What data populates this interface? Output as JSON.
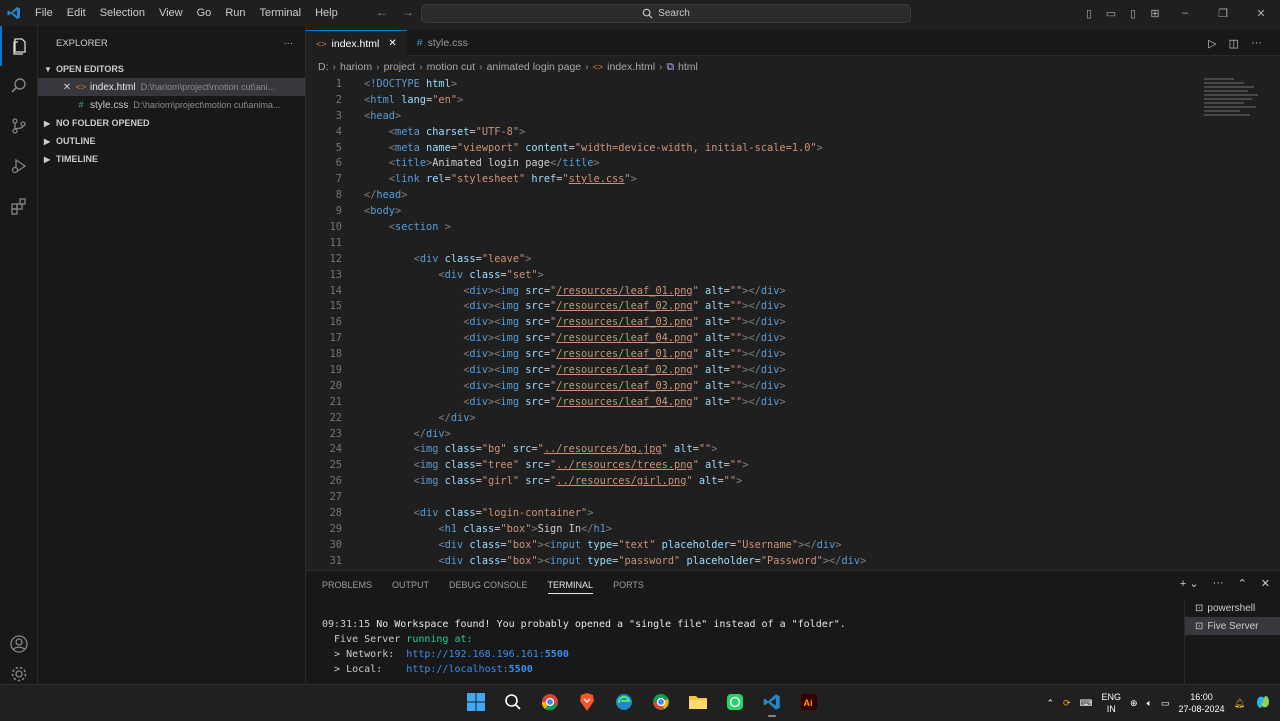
{
  "titlebar": {
    "menu": [
      "File",
      "Edit",
      "Selection",
      "View",
      "Go",
      "Run",
      "Terminal",
      "Help"
    ],
    "search": "Search"
  },
  "sidebar": {
    "title": "EXPLORER",
    "more": "···",
    "open_editors": "OPEN EDITORS",
    "files": [
      {
        "name": "index.html",
        "path": "D:\\hariom\\project\\motion cut\\ani..."
      },
      {
        "name": "style.css",
        "path": "D:\\hariom\\project\\motion cut\\anima..."
      }
    ],
    "sections": [
      "NO FOLDER OPENED",
      "OUTLINE",
      "TIMELINE"
    ]
  },
  "tabs": [
    {
      "label": "index.html",
      "icon": "<>"
    },
    {
      "label": "style.css",
      "icon": "#"
    }
  ],
  "breadcrumb": [
    "D:",
    "hariom",
    "project",
    "motion cut",
    "animated login page",
    "index.html",
    "html"
  ],
  "code_lines": [
    {
      "n": "1",
      "tokens": [
        [
          "p",
          "<"
        ],
        [
          "t",
          "!DOCTYPE "
        ],
        [
          "a",
          "html"
        ],
        [
          "p",
          ">"
        ]
      ]
    },
    {
      "n": "2",
      "tokens": [
        [
          "p",
          "<"
        ],
        [
          "t",
          "html "
        ],
        [
          "a",
          "lang"
        ],
        [
          "c",
          "="
        ],
        [
          "s",
          "\"en\""
        ],
        [
          "p",
          ">"
        ]
      ]
    },
    {
      "n": "3",
      "tokens": [
        [
          "p",
          "<"
        ],
        [
          "t",
          "head"
        ],
        [
          "p",
          ">"
        ]
      ]
    },
    {
      "n": "4",
      "tokens": [
        [
          "c",
          "    "
        ],
        [
          "p",
          "<"
        ],
        [
          "t",
          "meta "
        ],
        [
          "a",
          "charset"
        ],
        [
          "c",
          "="
        ],
        [
          "s",
          "\"UTF-8\""
        ],
        [
          "p",
          ">"
        ]
      ]
    },
    {
      "n": "5",
      "tokens": [
        [
          "c",
          "    "
        ],
        [
          "p",
          "<"
        ],
        [
          "t",
          "meta "
        ],
        [
          "a",
          "name"
        ],
        [
          "c",
          "="
        ],
        [
          "s",
          "\"viewport\" "
        ],
        [
          "a",
          "content"
        ],
        [
          "c",
          "="
        ],
        [
          "s",
          "\"width=device-width, initial-scale=1.0\""
        ],
        [
          "p",
          ">"
        ]
      ]
    },
    {
      "n": "6",
      "tokens": [
        [
          "c",
          "    "
        ],
        [
          "p",
          "<"
        ],
        [
          "t",
          "title"
        ],
        [
          "p",
          ">"
        ],
        [
          "c",
          "Animated login page"
        ],
        [
          "p",
          "</"
        ],
        [
          "t",
          "title"
        ],
        [
          "p",
          ">"
        ]
      ]
    },
    {
      "n": "7",
      "tokens": [
        [
          "c",
          "    "
        ],
        [
          "p",
          "<"
        ],
        [
          "t",
          "link "
        ],
        [
          "a",
          "rel"
        ],
        [
          "c",
          "="
        ],
        [
          "s",
          "\"stylesheet\" "
        ],
        [
          "a",
          "href"
        ],
        [
          "c",
          "="
        ],
        [
          "s",
          "\""
        ],
        [
          "u",
          "style.css"
        ],
        [
          "s",
          "\""
        ],
        [
          "p",
          ">"
        ]
      ]
    },
    {
      "n": "8",
      "tokens": [
        [
          "p",
          "</"
        ],
        [
          "t",
          "head"
        ],
        [
          "p",
          ">"
        ]
      ]
    },
    {
      "n": "9",
      "tokens": [
        [
          "p",
          "<"
        ],
        [
          "t",
          "body"
        ],
        [
          "p",
          ">"
        ]
      ]
    },
    {
      "n": "10",
      "tokens": [
        [
          "c",
          "    "
        ],
        [
          "p",
          "<"
        ],
        [
          "t",
          "section "
        ],
        [
          "p",
          ">"
        ]
      ]
    },
    {
      "n": "11",
      "tokens": []
    },
    {
      "n": "12",
      "tokens": [
        [
          "c",
          "        "
        ],
        [
          "p",
          "<"
        ],
        [
          "t",
          "div "
        ],
        [
          "a",
          "class"
        ],
        [
          "c",
          "="
        ],
        [
          "s",
          "\"leave\""
        ],
        [
          "p",
          ">"
        ]
      ]
    },
    {
      "n": "13",
      "tokens": [
        [
          "c",
          "            "
        ],
        [
          "p",
          "<"
        ],
        [
          "t",
          "div "
        ],
        [
          "a",
          "class"
        ],
        [
          "c",
          "="
        ],
        [
          "s",
          "\"set\""
        ],
        [
          "p",
          ">"
        ]
      ]
    },
    {
      "n": "14",
      "tokens": [
        [
          "c",
          "                "
        ],
        [
          "p",
          "<"
        ],
        [
          "t",
          "div"
        ],
        [
          "p",
          "><"
        ],
        [
          "t",
          "img "
        ],
        [
          "a",
          "src"
        ],
        [
          "c",
          "="
        ],
        [
          "s",
          "\""
        ],
        [
          "u",
          "/resources/leaf_01.png"
        ],
        [
          "s",
          "\" "
        ],
        [
          "a",
          "alt"
        ],
        [
          "c",
          "="
        ],
        [
          "s",
          "\"\""
        ],
        [
          "p",
          "></"
        ],
        [
          "t",
          "div"
        ],
        [
          "p",
          ">"
        ]
      ]
    },
    {
      "n": "15",
      "tokens": [
        [
          "c",
          "                "
        ],
        [
          "p",
          "<"
        ],
        [
          "t",
          "div"
        ],
        [
          "p",
          "><"
        ],
        [
          "t",
          "img "
        ],
        [
          "a",
          "src"
        ],
        [
          "c",
          "="
        ],
        [
          "s",
          "\""
        ],
        [
          "u",
          "/resources/leaf_02.png"
        ],
        [
          "s",
          "\" "
        ],
        [
          "a",
          "alt"
        ],
        [
          "c",
          "="
        ],
        [
          "s",
          "\"\""
        ],
        [
          "p",
          "></"
        ],
        [
          "t",
          "div"
        ],
        [
          "p",
          ">"
        ]
      ]
    },
    {
      "n": "16",
      "tokens": [
        [
          "c",
          "                "
        ],
        [
          "p",
          "<"
        ],
        [
          "t",
          "div"
        ],
        [
          "p",
          "><"
        ],
        [
          "t",
          "img "
        ],
        [
          "a",
          "src"
        ],
        [
          "c",
          "="
        ],
        [
          "s",
          "\""
        ],
        [
          "u",
          "/resources/leaf_03.png"
        ],
        [
          "s",
          "\" "
        ],
        [
          "a",
          "alt"
        ],
        [
          "c",
          "="
        ],
        [
          "s",
          "\"\""
        ],
        [
          "p",
          "></"
        ],
        [
          "t",
          "div"
        ],
        [
          "p",
          ">"
        ]
      ]
    },
    {
      "n": "17",
      "tokens": [
        [
          "c",
          "                "
        ],
        [
          "p",
          "<"
        ],
        [
          "t",
          "div"
        ],
        [
          "p",
          "><"
        ],
        [
          "t",
          "img "
        ],
        [
          "a",
          "src"
        ],
        [
          "c",
          "="
        ],
        [
          "s",
          "\""
        ],
        [
          "u",
          "/resources/leaf_04.png"
        ],
        [
          "s",
          "\" "
        ],
        [
          "a",
          "alt"
        ],
        [
          "c",
          "="
        ],
        [
          "s",
          "\"\""
        ],
        [
          "p",
          "></"
        ],
        [
          "t",
          "div"
        ],
        [
          "p",
          ">"
        ]
      ]
    },
    {
      "n": "18",
      "tokens": [
        [
          "c",
          "                "
        ],
        [
          "p",
          "<"
        ],
        [
          "t",
          "div"
        ],
        [
          "p",
          "><"
        ],
        [
          "t",
          "img "
        ],
        [
          "a",
          "src"
        ],
        [
          "c",
          "="
        ],
        [
          "s",
          "\""
        ],
        [
          "u",
          "/resources/leaf_01.png"
        ],
        [
          "s",
          "\" "
        ],
        [
          "a",
          "alt"
        ],
        [
          "c",
          "="
        ],
        [
          "s",
          "\"\""
        ],
        [
          "p",
          "></"
        ],
        [
          "t",
          "div"
        ],
        [
          "p",
          ">"
        ]
      ]
    },
    {
      "n": "19",
      "tokens": [
        [
          "c",
          "                "
        ],
        [
          "p",
          "<"
        ],
        [
          "t",
          "div"
        ],
        [
          "p",
          "><"
        ],
        [
          "t",
          "img "
        ],
        [
          "a",
          "src"
        ],
        [
          "c",
          "="
        ],
        [
          "s",
          "\""
        ],
        [
          "u",
          "/resources/leaf_02.png"
        ],
        [
          "s",
          "\" "
        ],
        [
          "a",
          "alt"
        ],
        [
          "c",
          "="
        ],
        [
          "s",
          "\"\""
        ],
        [
          "p",
          "></"
        ],
        [
          "t",
          "div"
        ],
        [
          "p",
          ">"
        ]
      ]
    },
    {
      "n": "20",
      "tokens": [
        [
          "c",
          "                "
        ],
        [
          "p",
          "<"
        ],
        [
          "t",
          "div"
        ],
        [
          "p",
          "><"
        ],
        [
          "t",
          "img "
        ],
        [
          "a",
          "src"
        ],
        [
          "c",
          "="
        ],
        [
          "s",
          "\""
        ],
        [
          "u",
          "/resources/leaf_03.png"
        ],
        [
          "s",
          "\" "
        ],
        [
          "a",
          "alt"
        ],
        [
          "c",
          "="
        ],
        [
          "s",
          "\"\""
        ],
        [
          "p",
          "></"
        ],
        [
          "t",
          "div"
        ],
        [
          "p",
          ">"
        ]
      ]
    },
    {
      "n": "21",
      "tokens": [
        [
          "c",
          "                "
        ],
        [
          "p",
          "<"
        ],
        [
          "t",
          "div"
        ],
        [
          "p",
          "><"
        ],
        [
          "t",
          "img "
        ],
        [
          "a",
          "src"
        ],
        [
          "c",
          "="
        ],
        [
          "s",
          "\""
        ],
        [
          "u",
          "/resources/leaf_04.png"
        ],
        [
          "s",
          "\" "
        ],
        [
          "a",
          "alt"
        ],
        [
          "c",
          "="
        ],
        [
          "s",
          "\"\""
        ],
        [
          "p",
          "></"
        ],
        [
          "t",
          "div"
        ],
        [
          "p",
          ">"
        ]
      ]
    },
    {
      "n": "22",
      "tokens": [
        [
          "c",
          "            "
        ],
        [
          "p",
          "</"
        ],
        [
          "t",
          "div"
        ],
        [
          "p",
          ">"
        ]
      ]
    },
    {
      "n": "23",
      "tokens": [
        [
          "c",
          "        "
        ],
        [
          "p",
          "</"
        ],
        [
          "t",
          "div"
        ],
        [
          "p",
          ">"
        ]
      ]
    },
    {
      "n": "24",
      "tokens": [
        [
          "c",
          "        "
        ],
        [
          "p",
          "<"
        ],
        [
          "t",
          "img "
        ],
        [
          "a",
          "class"
        ],
        [
          "c",
          "="
        ],
        [
          "s",
          "\"bg\" "
        ],
        [
          "a",
          "src"
        ],
        [
          "c",
          "="
        ],
        [
          "s",
          "\""
        ],
        [
          "u",
          "../resources/bg.jpg"
        ],
        [
          "s",
          "\" "
        ],
        [
          "a",
          "alt"
        ],
        [
          "c",
          "="
        ],
        [
          "s",
          "\"\""
        ],
        [
          "p",
          ">"
        ]
      ]
    },
    {
      "n": "25",
      "tokens": [
        [
          "c",
          "        "
        ],
        [
          "p",
          "<"
        ],
        [
          "t",
          "img "
        ],
        [
          "a",
          "class"
        ],
        [
          "c",
          "="
        ],
        [
          "s",
          "\"tree\" "
        ],
        [
          "a",
          "src"
        ],
        [
          "c",
          "="
        ],
        [
          "s",
          "\""
        ],
        [
          "u",
          "../resources/trees.png"
        ],
        [
          "s",
          "\" "
        ],
        [
          "a",
          "alt"
        ],
        [
          "c",
          "="
        ],
        [
          "s",
          "\"\""
        ],
        [
          "p",
          ">"
        ]
      ]
    },
    {
      "n": "26",
      "tokens": [
        [
          "c",
          "        "
        ],
        [
          "p",
          "<"
        ],
        [
          "t",
          "img "
        ],
        [
          "a",
          "class"
        ],
        [
          "c",
          "="
        ],
        [
          "s",
          "\"girl\" "
        ],
        [
          "a",
          "src"
        ],
        [
          "c",
          "="
        ],
        [
          "s",
          "\""
        ],
        [
          "u",
          "../resources/girl.png"
        ],
        [
          "s",
          "\" "
        ],
        [
          "a",
          "alt"
        ],
        [
          "c",
          "="
        ],
        [
          "s",
          "\"\""
        ],
        [
          "p",
          ">"
        ]
      ]
    },
    {
      "n": "27",
      "tokens": []
    },
    {
      "n": "28",
      "tokens": [
        [
          "c",
          "        "
        ],
        [
          "p",
          "<"
        ],
        [
          "t",
          "div "
        ],
        [
          "a",
          "class"
        ],
        [
          "c",
          "="
        ],
        [
          "s",
          "\"login-container\""
        ],
        [
          "p",
          ">"
        ]
      ]
    },
    {
      "n": "29",
      "tokens": [
        [
          "c",
          "            "
        ],
        [
          "p",
          "<"
        ],
        [
          "t",
          "h1 "
        ],
        [
          "a",
          "class"
        ],
        [
          "c",
          "="
        ],
        [
          "s",
          "\"box\""
        ],
        [
          "p",
          ">"
        ],
        [
          "c",
          "Sign In"
        ],
        [
          "p",
          "</"
        ],
        [
          "t",
          "h1"
        ],
        [
          "p",
          ">"
        ]
      ]
    },
    {
      "n": "30",
      "tokens": [
        [
          "c",
          "            "
        ],
        [
          "p",
          "<"
        ],
        [
          "t",
          "div "
        ],
        [
          "a",
          "class"
        ],
        [
          "c",
          "="
        ],
        [
          "s",
          "\"box\""
        ],
        [
          "p",
          "><"
        ],
        [
          "t",
          "input "
        ],
        [
          "a",
          "type"
        ],
        [
          "c",
          "="
        ],
        [
          "s",
          "\"text\" "
        ],
        [
          "a",
          "placeholder"
        ],
        [
          "c",
          "="
        ],
        [
          "s",
          "\"Username\""
        ],
        [
          "p",
          "></"
        ],
        [
          "t",
          "div"
        ],
        [
          "p",
          ">"
        ]
      ]
    },
    {
      "n": "31",
      "tokens": [
        [
          "c",
          "            "
        ],
        [
          "p",
          "<"
        ],
        [
          "t",
          "div "
        ],
        [
          "a",
          "class"
        ],
        [
          "c",
          "="
        ],
        [
          "s",
          "\"box\""
        ],
        [
          "p",
          "><"
        ],
        [
          "t",
          "input "
        ],
        [
          "a",
          "type"
        ],
        [
          "c",
          "="
        ],
        [
          "s",
          "\"password\" "
        ],
        [
          "a",
          "placeholder"
        ],
        [
          "c",
          "="
        ],
        [
          "s",
          "\"Password\""
        ],
        [
          "p",
          "></"
        ],
        [
          "t",
          "div"
        ],
        [
          "p",
          ">"
        ]
      ]
    }
  ],
  "panel": {
    "tabs": [
      "PROBLEMS",
      "OUTPUT",
      "DEBUG CONSOLE",
      "TERMINAL",
      "PORTS"
    ],
    "active_tab": "TERMINAL",
    "terminal": {
      "line1_time": "09:31:15",
      "line1_text": " No Workspace found! You probably opened a \"single file\" instead of a \"folder\".",
      "line2_a": "  Five Server ",
      "line2_b": "running at:",
      "network_label": "  > Network:  ",
      "network_host": "http://192.168.196.161:",
      "network_port": "5500",
      "local_label": "  > Local:    ",
      "local_host": "http://localhost:",
      "local_port": "5500"
    },
    "terminals": [
      "powershell",
      "Five Server"
    ]
  },
  "taskbar": {
    "lang1": "ENG",
    "lang2": "IN",
    "time": "16:00",
    "date": "27-08-2024"
  }
}
